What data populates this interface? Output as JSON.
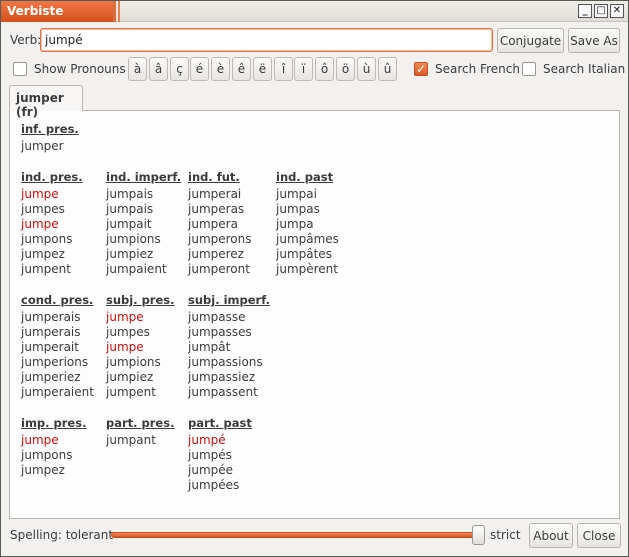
{
  "window": {
    "title": "Verbiste",
    "controls": {
      "minimize": "_",
      "maximize": "□",
      "close": "✕"
    }
  },
  "toolbar": {
    "verb_label": "Verb:",
    "verb_value": "jumpé",
    "conjugate_label": "Conjugate",
    "save_as_label": "Save As"
  },
  "options": {
    "show_pronouns_label": "Show Pronouns",
    "show_pronouns_checked": false,
    "accent_buttons": [
      "à",
      "â",
      "ç",
      "é",
      "è",
      "ê",
      "ë",
      "î",
      "ï",
      "ô",
      "ö",
      "ù",
      "û"
    ],
    "search_french_label": "Search French",
    "search_french_checked": true,
    "search_italian_label": "Search Italian",
    "search_italian_checked": false
  },
  "tab": {
    "label": "jumper (fr)"
  },
  "conjugation": {
    "inf_pres": {
      "title": "inf. pres.",
      "forms": [
        {
          "t": "jumper",
          "irregular": false
        }
      ]
    },
    "ind_pres": {
      "title": "ind. pres.",
      "forms": [
        {
          "t": "jumpe",
          "irregular": true
        },
        {
          "t": "jumpes",
          "irregular": false
        },
        {
          "t": "jumpe",
          "irregular": true
        },
        {
          "t": "jumpons",
          "irregular": false
        },
        {
          "t": "jumpez",
          "irregular": false
        },
        {
          "t": "jumpent",
          "irregular": false
        }
      ]
    },
    "ind_imperf": {
      "title": "ind. imperf.",
      "forms": [
        {
          "t": "jumpais",
          "irregular": false
        },
        {
          "t": "jumpais",
          "irregular": false
        },
        {
          "t": "jumpait",
          "irregular": false
        },
        {
          "t": "jumpions",
          "irregular": false
        },
        {
          "t": "jumpiez",
          "irregular": false
        },
        {
          "t": "jumpaient",
          "irregular": false
        }
      ]
    },
    "ind_fut": {
      "title": "ind. fut.",
      "forms": [
        {
          "t": "jumperai",
          "irregular": false
        },
        {
          "t": "jumperas",
          "irregular": false
        },
        {
          "t": "jumpera",
          "irregular": false
        },
        {
          "t": "jumperons",
          "irregular": false
        },
        {
          "t": "jumperez",
          "irregular": false
        },
        {
          "t": "jumperont",
          "irregular": false
        }
      ]
    },
    "ind_past": {
      "title": "ind. past",
      "forms": [
        {
          "t": "jumpai",
          "irregular": false
        },
        {
          "t": "jumpas",
          "irregular": false
        },
        {
          "t": "jumpa",
          "irregular": false
        },
        {
          "t": "jumpâmes",
          "irregular": false
        },
        {
          "t": "jumpâtes",
          "irregular": false
        },
        {
          "t": "jumpèrent",
          "irregular": false
        }
      ]
    },
    "cond_pres": {
      "title": "cond. pres.",
      "forms": [
        {
          "t": "jumperais",
          "irregular": false
        },
        {
          "t": "jumperais",
          "irregular": false
        },
        {
          "t": "jumperait",
          "irregular": false
        },
        {
          "t": "jumperions",
          "irregular": false
        },
        {
          "t": "jumperiez",
          "irregular": false
        },
        {
          "t": "jumperaient",
          "irregular": false
        }
      ]
    },
    "subj_pres": {
      "title": "subj. pres.",
      "forms": [
        {
          "t": "jumpe",
          "irregular": true
        },
        {
          "t": "jumpes",
          "irregular": false
        },
        {
          "t": "jumpe",
          "irregular": true
        },
        {
          "t": "jumpions",
          "irregular": false
        },
        {
          "t": "jumpiez",
          "irregular": false
        },
        {
          "t": "jumpent",
          "irregular": false
        }
      ]
    },
    "subj_imperf": {
      "title": "subj. imperf.",
      "forms": [
        {
          "t": "jumpasse",
          "irregular": false
        },
        {
          "t": "jumpasses",
          "irregular": false
        },
        {
          "t": "jumpât",
          "irregular": false
        },
        {
          "t": "jumpassions",
          "irregular": false
        },
        {
          "t": "jumpassiez",
          "irregular": false
        },
        {
          "t": "jumpassent",
          "irregular": false
        }
      ]
    },
    "imp_pres": {
      "title": "imp. pres.",
      "forms": [
        {
          "t": "jumpe",
          "irregular": true
        },
        {
          "t": "jumpons",
          "irregular": false
        },
        {
          "t": "jumpez",
          "irregular": false
        }
      ]
    },
    "part_pres": {
      "title": "part. pres.",
      "forms": [
        {
          "t": "jumpant",
          "irregular": false
        }
      ]
    },
    "part_past": {
      "title": "part. past",
      "forms": [
        {
          "t": "jumpé",
          "irregular": true
        },
        {
          "t": "jumpés",
          "irregular": false
        },
        {
          "t": "jumpée",
          "irregular": false
        },
        {
          "t": "jumpées",
          "irregular": false
        }
      ]
    }
  },
  "footer": {
    "spelling_label": "Spelling: tolerant",
    "strict_label": "strict",
    "spelling_strictness": 1.0,
    "about_label": "About",
    "close_label": "Close"
  },
  "colors": {
    "accent": "#dd5a24",
    "irregular_form": "#cc1010"
  }
}
